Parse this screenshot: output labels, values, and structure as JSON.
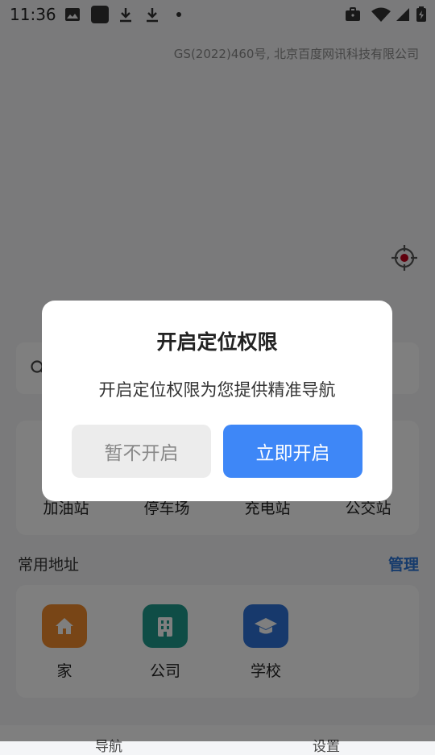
{
  "status_bar": {
    "time": "11:36"
  },
  "map": {
    "copyright": "GS(2022)460号, 北京百度网讯科技有限公司"
  },
  "quick_access": {
    "items": [
      {
        "label": "加油站"
      },
      {
        "label": "停车场"
      },
      {
        "label": "充电站"
      },
      {
        "label": "公交站"
      }
    ]
  },
  "addresses": {
    "title": "常用地址",
    "manage": "管理",
    "items": [
      {
        "label": "家",
        "icon": "home-icon",
        "color": "#f08a2c"
      },
      {
        "label": "公司",
        "icon": "building-icon",
        "color": "#1f9a8c"
      },
      {
        "label": "学校",
        "icon": "graduation-cap-icon",
        "color": "#2f73d9"
      }
    ]
  },
  "bottom_nav": {
    "nav": "导航",
    "settings": "设置"
  },
  "dialog": {
    "title": "开启定位权限",
    "message": "开启定位权限为您提供精准导航",
    "later_label": "暂不开启",
    "enable_label": "立即开启"
  },
  "colors": {
    "accent": "#3e87f7",
    "link": "#2d76d8"
  }
}
